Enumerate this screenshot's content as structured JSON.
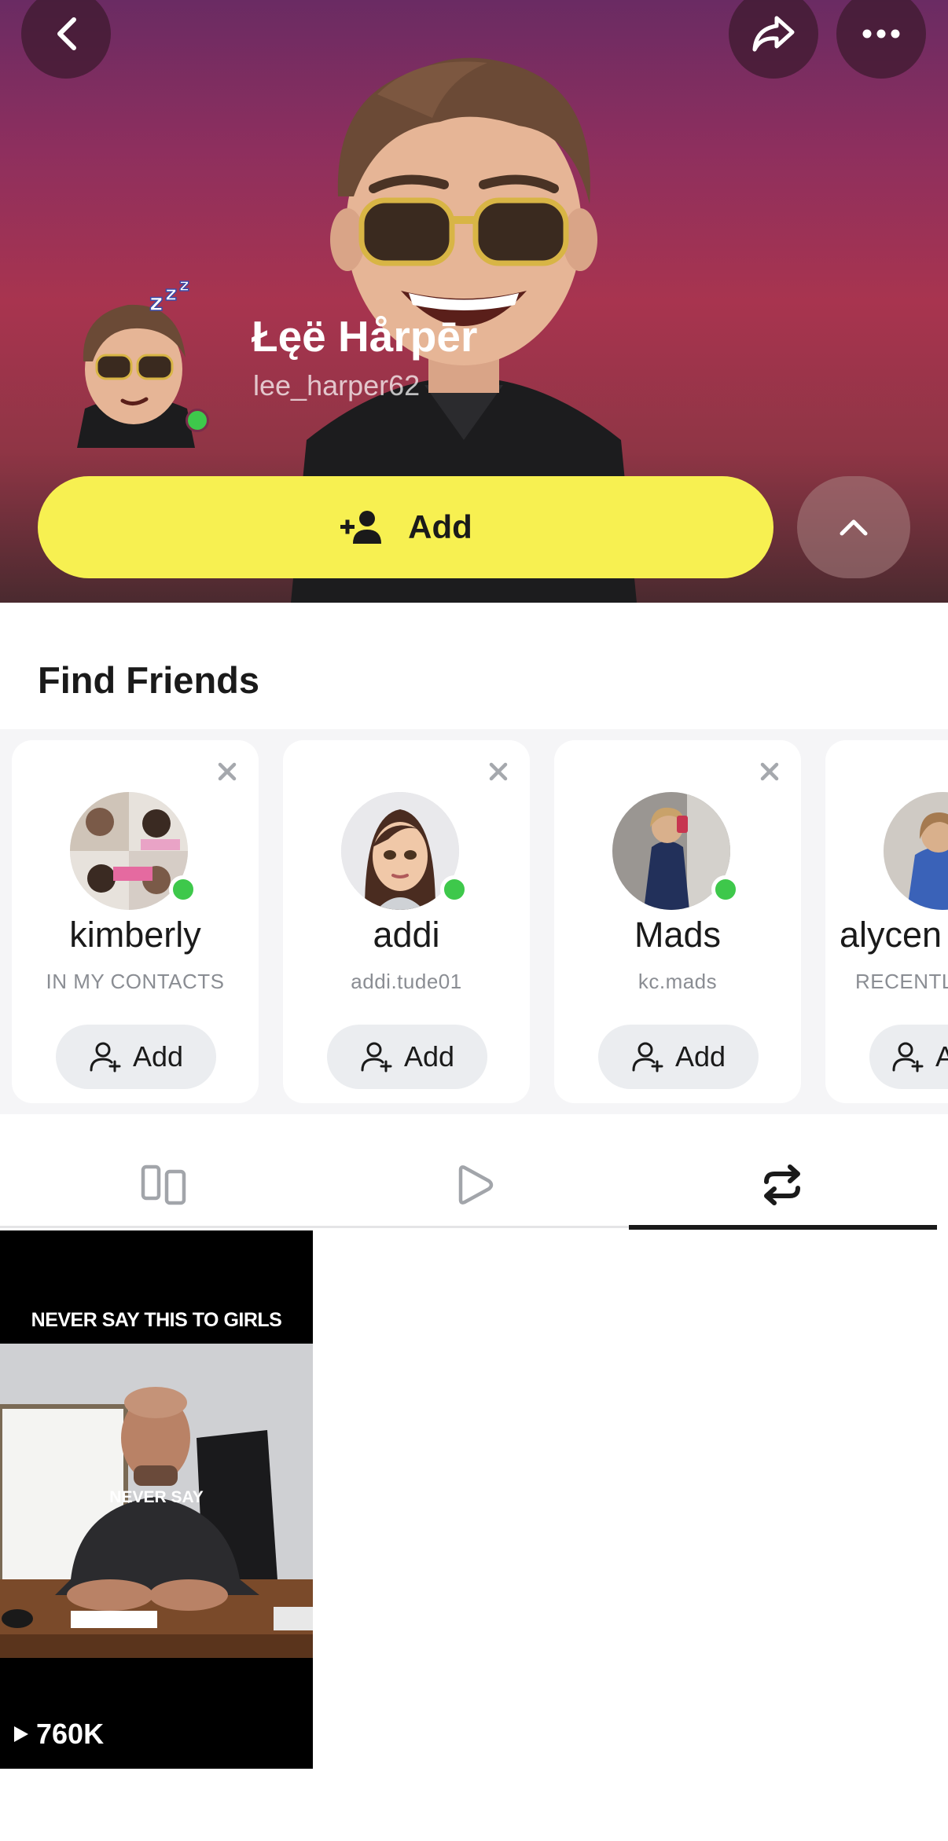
{
  "profile": {
    "display_name": "Łęë Hårpēr",
    "username": "lee_harper62",
    "online": true
  },
  "header_actions": {
    "back_icon": "chevron-left-icon",
    "share_icon": "share-arrow-icon",
    "more_icon": "more-horizontal-icon",
    "collapse_icon": "chevron-up-icon"
  },
  "primary_action": {
    "label": "Add",
    "icon": "add-friend-icon",
    "color": "#f7f051"
  },
  "find_friends": {
    "title": "Find Friends",
    "cards": [
      {
        "name": "kimberly",
        "subtitle": "IN MY CONTACTS",
        "add_label": "Add",
        "online": true
      },
      {
        "name": "addi",
        "subtitle": "addi.tude01",
        "add_label": "Add",
        "online": true
      },
      {
        "name": "Mads",
        "subtitle": "kc.mads",
        "add_label": "Add",
        "online": true
      },
      {
        "name": "alycen",
        "subtitle": "RECENTLY",
        "add_label": "Add",
        "online": false
      }
    ]
  },
  "tabs": [
    {
      "icon": "stories-grid-icon",
      "active": false
    },
    {
      "icon": "play-icon",
      "active": false
    },
    {
      "icon": "repost-icon",
      "active": true
    }
  ],
  "spotlight": {
    "caption": "NEVER SAY THIS TO GIRLS",
    "overlay_text": "NEVER SAY",
    "views": "760K",
    "views_icon": "play-small-icon"
  },
  "colors": {
    "accent_yellow": "#f7f051",
    "online_green": "#3ec84b",
    "header_top": "#6a2b63",
    "header_mid": "#a8344f"
  }
}
